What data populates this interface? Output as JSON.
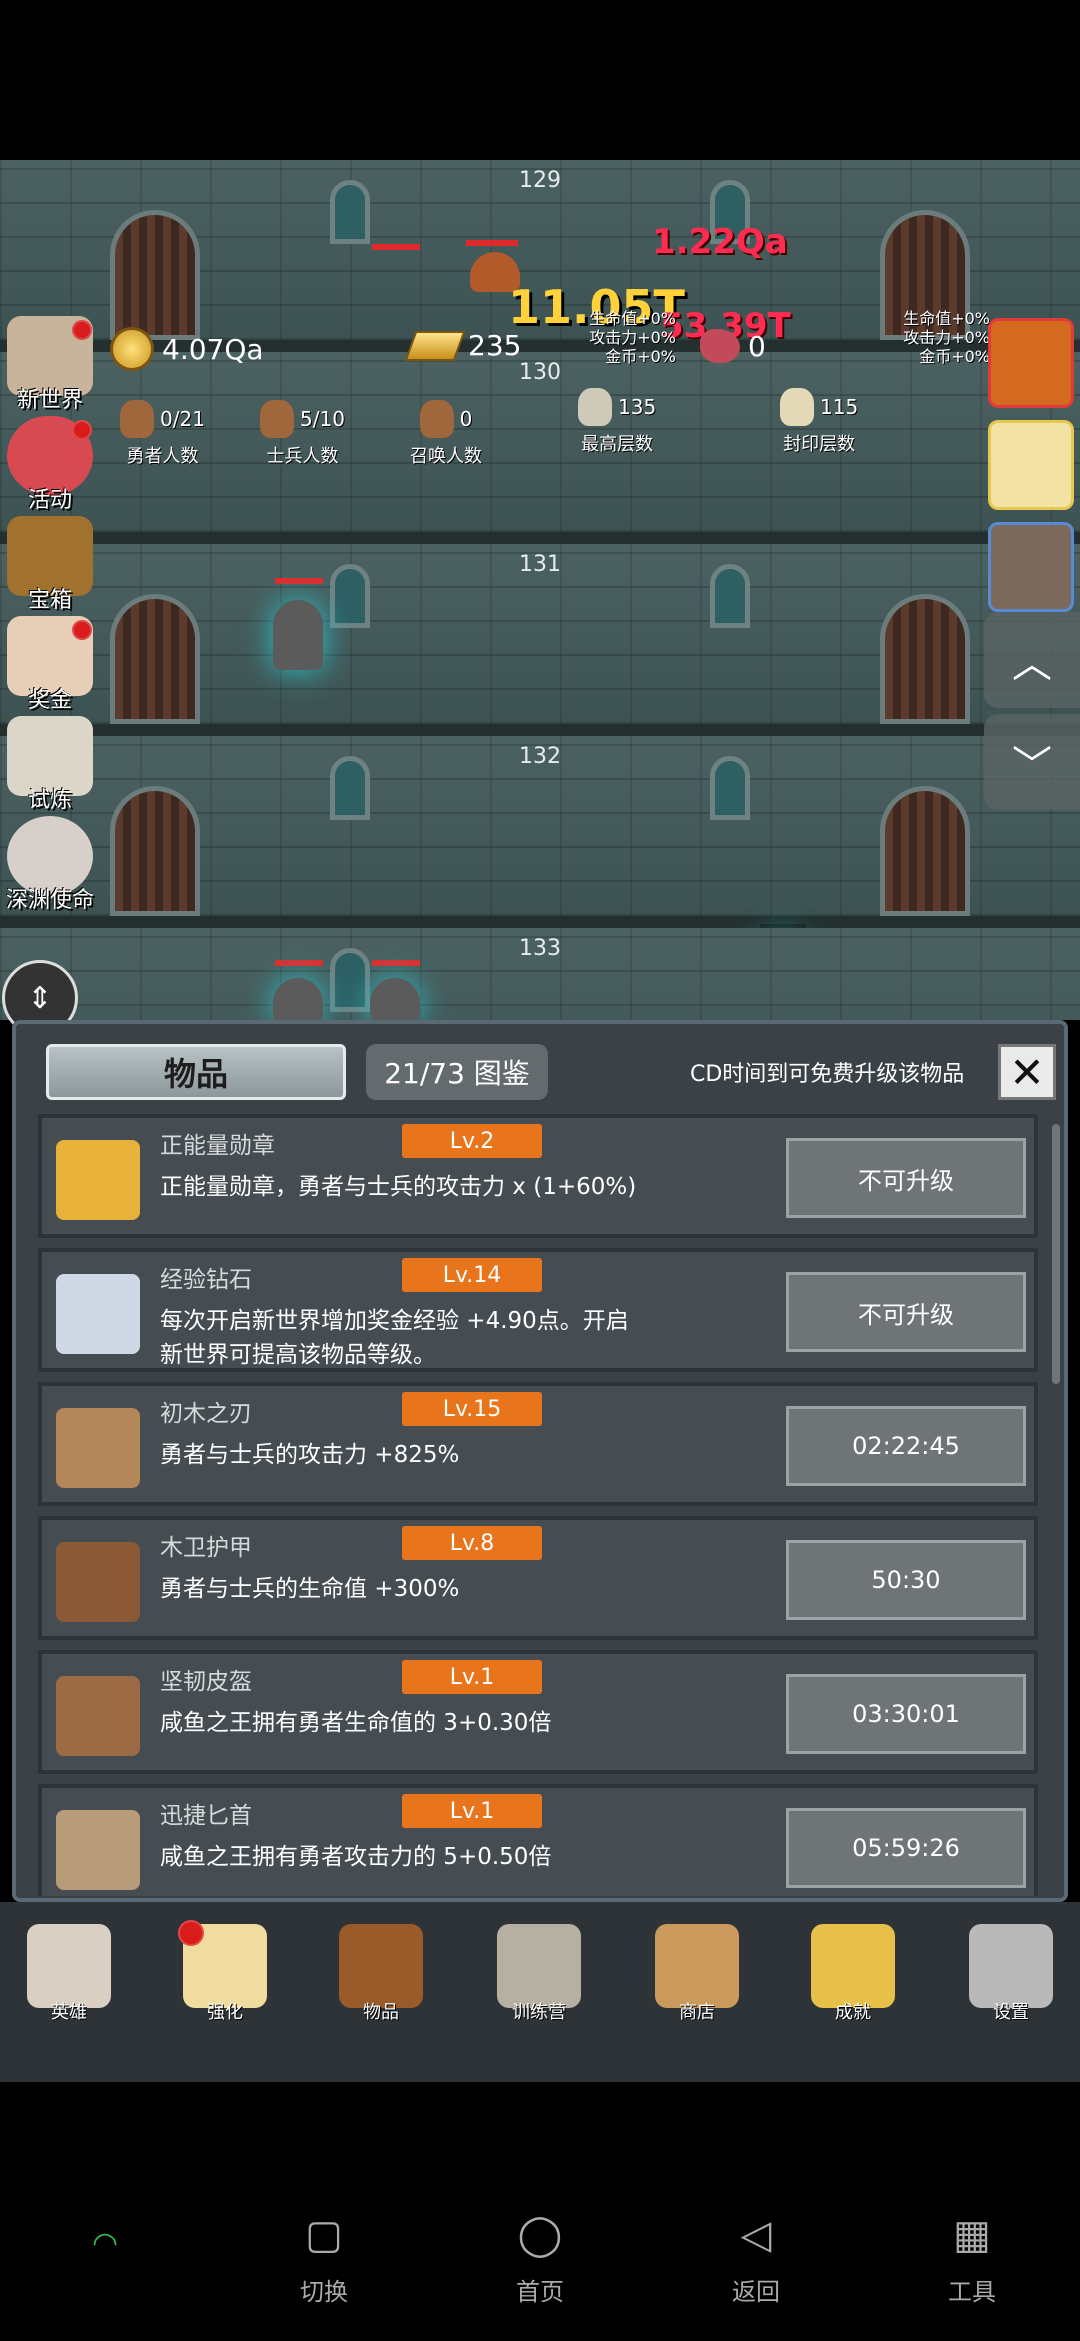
{
  "floors": [
    "129",
    "130",
    "131",
    "132",
    "133"
  ],
  "damage_numbers": [
    "1.22Qa",
    "11.05T",
    "53.39T"
  ],
  "resources": {
    "gold": "4.07Qa",
    "ingots": "235",
    "meat": "0",
    "stats_left": [
      "生命值+0%",
      "攻击力+0%",
      "金币+0%"
    ],
    "stats_right": [
      "生命值+0%",
      "攻击力+0%",
      "金币+0%"
    ]
  },
  "units": [
    {
      "value": "0/21",
      "label": "勇者人数"
    },
    {
      "value": "5/10",
      "label": "士兵人数"
    },
    {
      "value": "0",
      "label": "召唤人数"
    },
    {
      "value": "135",
      "label": "最高层数"
    },
    {
      "value": "115",
      "label": "封印层数"
    }
  ],
  "side_menu": [
    "新世界",
    "活动",
    "宝箱",
    "奖金",
    "试炼",
    "深渊使命"
  ],
  "panel": {
    "tab_active": "物品",
    "tab_other": "21/73 图鉴",
    "cd_note": "CD时间到可免费升级该物品",
    "close": "✕",
    "items": [
      {
        "name": "正能量勋章",
        "level": "Lv.2",
        "desc": "正能量勋章，勇者与士兵的攻击力 x (1+60%)",
        "action": "不可升级",
        "icon": "crown-icon",
        "color": "#e8b23a"
      },
      {
        "name": "经验钻石",
        "level": "Lv.14",
        "desc": "每次开启新世界增加奖金经验 +4.90点。开启新世界可提高该物品等级。",
        "action": "不可升级",
        "icon": "diamond-icon",
        "color": "#cfd9e6"
      },
      {
        "name": "初木之刃",
        "level": "Lv.15",
        "desc": "勇者与士兵的攻击力 +825%",
        "action": "02:22:45",
        "icon": "wooden-sword-icon",
        "color": "#b4875a"
      },
      {
        "name": "木卫护甲",
        "level": "Lv.8",
        "desc": "勇者与士兵的生命值 +300%",
        "action": "50:30",
        "icon": "armor-icon",
        "color": "#8a5a36"
      },
      {
        "name": "坚韧皮盔",
        "level": "Lv.1",
        "desc": "咸鱼之王拥有勇者生命值的 3+0.30倍",
        "action": "03:30:01",
        "icon": "helmet-icon",
        "color": "#9c6a45"
      },
      {
        "name": "迅捷匕首",
        "level": "Lv.1",
        "desc": "咸鱼之王拥有勇者攻击力的 5+0.50倍",
        "action": "05:59:26",
        "icon": "dagger-icon",
        "color": "#b89b78"
      }
    ]
  },
  "game_nav": [
    {
      "label": "英雄",
      "icon": "skull-icon",
      "color": "#d9cfc2"
    },
    {
      "label": "强化",
      "icon": "candle-icon",
      "color": "#f1dca0"
    },
    {
      "label": "物品",
      "icon": "book-icon",
      "color": "#9a5b2b"
    },
    {
      "label": "训练营",
      "icon": "lantern-icon",
      "color": "#b6b0a2"
    },
    {
      "label": "商店",
      "icon": "beer-mug-icon",
      "color": "#c99a5c"
    },
    {
      "label": "成就",
      "icon": "key-icon",
      "color": "#e7c04a"
    },
    {
      "label": "设置",
      "icon": "gear-icon",
      "color": "#b9b9b9"
    }
  ],
  "system_nav": [
    {
      "label": "切换",
      "icon": "square-icon",
      "symbol": "▢"
    },
    {
      "label": "首页",
      "icon": "circle-icon",
      "symbol": "◯"
    },
    {
      "label": "返回",
      "icon": "back-triangle-icon",
      "symbol": "◁"
    },
    {
      "label": "工具",
      "icon": "grid-icon",
      "symbol": "▦"
    }
  ]
}
